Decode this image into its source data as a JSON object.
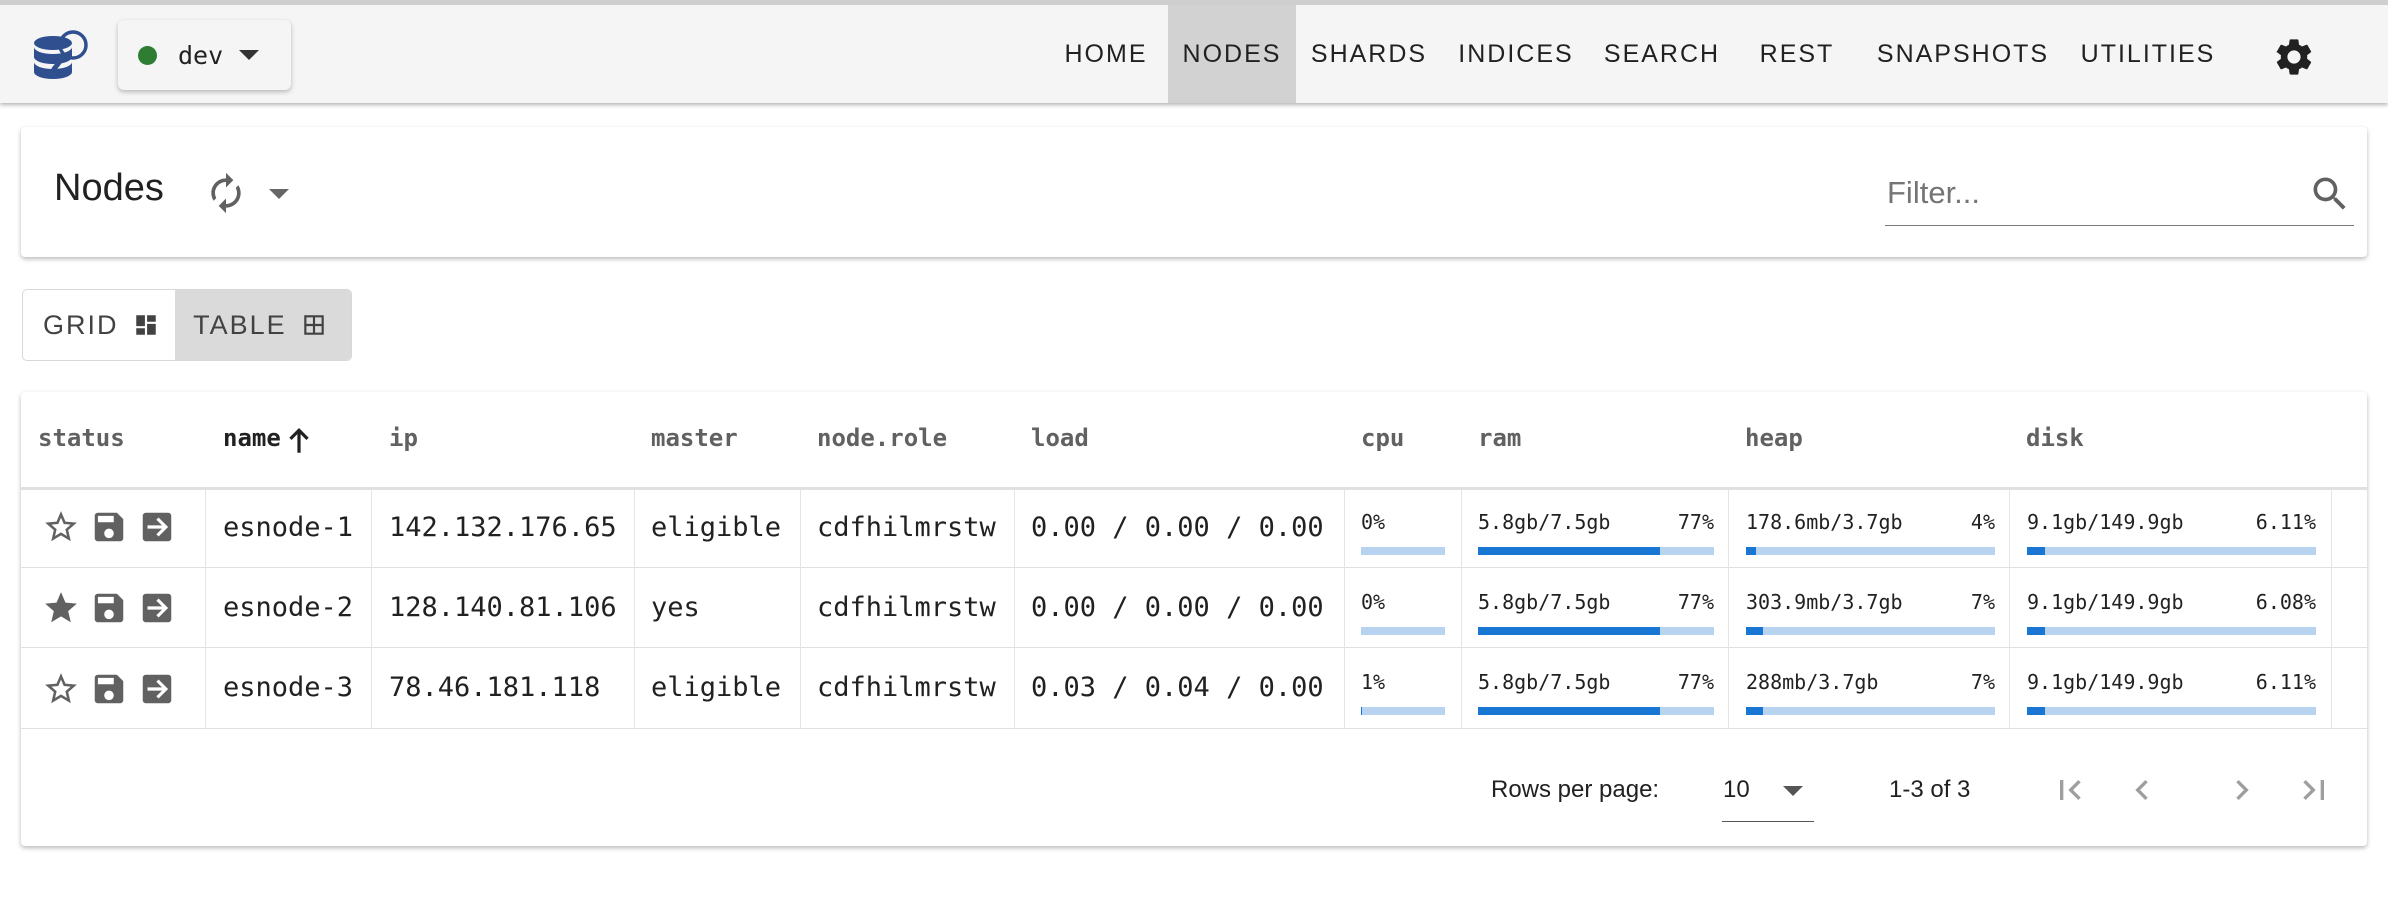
{
  "topbar": {
    "logo": "database-search-logo",
    "cluster": {
      "name": "dev",
      "status_color": "#2e7d32"
    },
    "nav": [
      {
        "label": "HOME",
        "active": false
      },
      {
        "label": "NODES",
        "active": true
      },
      {
        "label": "SHARDS",
        "active": false
      },
      {
        "label": "INDICES",
        "active": false
      },
      {
        "label": "SEARCH",
        "active": false
      },
      {
        "label": "REST",
        "active": false
      },
      {
        "label": "SNAPSHOTS",
        "active": false
      },
      {
        "label": "UTILITIES",
        "active": false
      }
    ],
    "settings_icon": "gear-icon"
  },
  "header": {
    "title": "Nodes",
    "refresh_icon": "refresh-icon",
    "filter": {
      "value": "",
      "placeholder": "Filter..."
    }
  },
  "view_toggle": {
    "grid_label": "GRID",
    "table_label": "TABLE",
    "selected": "TABLE"
  },
  "table": {
    "columns": [
      "status",
      "name",
      "ip",
      "master",
      "node.role",
      "load",
      "cpu",
      "ram",
      "heap",
      "disk"
    ],
    "sorted_column": "name",
    "sort_direction": "ascending",
    "rows": [
      {
        "favorite": false,
        "name": "esnode-1",
        "ip": "142.132.176.65",
        "master": "eligible",
        "role": "cdfhilmrstw",
        "load": "0.00 / 0.00 / 0.00",
        "cpu": {
          "pct": "0%",
          "value": 0
        },
        "ram": {
          "text": "5.8gb/7.5gb",
          "pct": "77%",
          "value": 77
        },
        "heap": {
          "text": "178.6mb/3.7gb",
          "pct": "4%",
          "value": 4
        },
        "disk": {
          "text": "9.1gb/149.9gb",
          "pct": "6.11%",
          "value": 6.11
        }
      },
      {
        "favorite": true,
        "name": "esnode-2",
        "ip": "128.140.81.106",
        "master": "yes",
        "role": "cdfhilmrstw",
        "load": "0.00 / 0.00 / 0.00",
        "cpu": {
          "pct": "0%",
          "value": 0
        },
        "ram": {
          "text": "5.8gb/7.5gb",
          "pct": "77%",
          "value": 77
        },
        "heap": {
          "text": "303.9mb/3.7gb",
          "pct": "7%",
          "value": 7
        },
        "disk": {
          "text": "9.1gb/149.9gb",
          "pct": "6.08%",
          "value": 6.08
        }
      },
      {
        "favorite": false,
        "name": "esnode-3",
        "ip": "78.46.181.118",
        "master": "eligible",
        "role": "cdfhilmrstw",
        "load": "0.03 / 0.04 / 0.00",
        "cpu": {
          "pct": "1%",
          "value": 1
        },
        "ram": {
          "text": "5.8gb/7.5gb",
          "pct": "77%",
          "value": 77
        },
        "heap": {
          "text": "288mb/3.7gb",
          "pct": "7%",
          "value": 7
        },
        "disk": {
          "text": "9.1gb/149.9gb",
          "pct": "6.11%",
          "value": 6.11
        }
      }
    ]
  },
  "pagination": {
    "rows_per_page_label": "Rows per page:",
    "rows_per_page": "10",
    "range": "1-3 of 3"
  },
  "colors": {
    "meter_fill": "#1976d2",
    "meter_track": "#b8d3f0",
    "active_nav": "#d2d2d2",
    "status_dot": "#2e7d32"
  }
}
